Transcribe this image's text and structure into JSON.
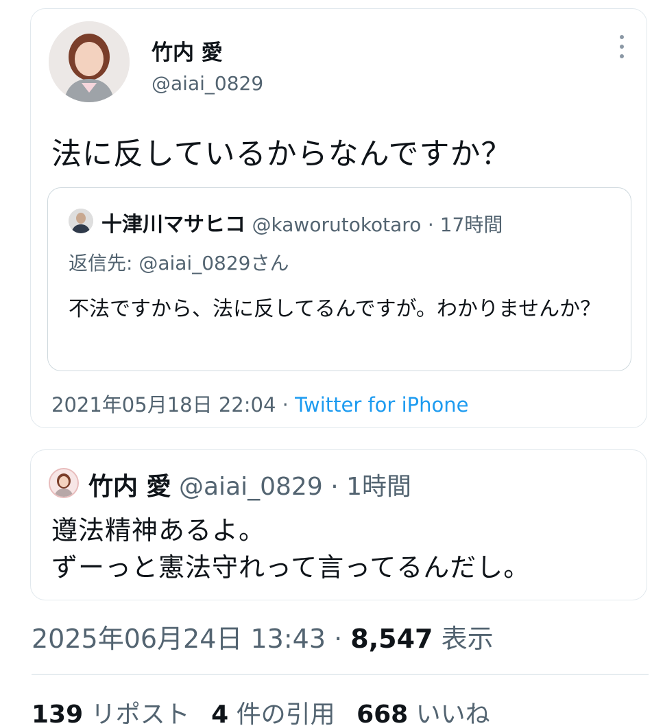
{
  "quoted_tweet_card": {
    "author_name": "竹内 愛",
    "author_handle": "@aiai_0829",
    "text": "法に反しているからなんですか？",
    "quote": {
      "name": "十津川マサヒコ",
      "handle": "@kaworutokotaro",
      "time": "· 17時間",
      "reply_to": "返信先: @aiai_0829さん",
      "text": "不法ですから、法に反してるんですが。わかりませんか？"
    },
    "timestamp": "2021年05月18日 22:04 ·",
    "source": "Twitter for iPhone"
  },
  "reply_card": {
    "name": "竹内 愛",
    "handle": "@aiai_0829",
    "time": "· 1時間",
    "line1": "遵法精神あるよ。",
    "line2": "ずーっと憲法守れって言ってるんだし。"
  },
  "meta": {
    "timestamp": "2025年06月24日 13:43 ·",
    "views": "8,547",
    "views_label": "表示"
  },
  "stats": {
    "reposts": "139",
    "reposts_label": "リポスト",
    "quotes": "4",
    "quotes_label": "件の引用",
    "likes": "668",
    "likes_label": "いいね"
  },
  "icons": {
    "more": "more-vertical-icon"
  }
}
